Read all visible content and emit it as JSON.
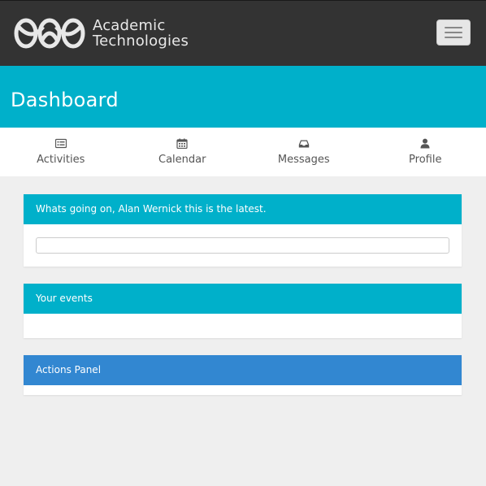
{
  "header": {
    "brand_line1": "Academic",
    "brand_line2": "Technologies"
  },
  "page": {
    "title": "Dashboard"
  },
  "tabs": [
    {
      "label": "Activities",
      "icon": "list-icon"
    },
    {
      "label": "Calendar",
      "icon": "calendar-icon"
    },
    {
      "label": "Messages",
      "icon": "inbox-icon"
    },
    {
      "label": "Profile",
      "icon": "user-icon"
    }
  ],
  "panels": {
    "latest": {
      "heading": "Whats going on, Alan Wernick this is the latest.",
      "input_value": ""
    },
    "events": {
      "heading": "Your events"
    },
    "actions": {
      "heading": "Actions Panel"
    }
  },
  "colors": {
    "navbar": "#333333",
    "accent_teal": "#00b0ca",
    "accent_blue": "#3287d1",
    "background": "#efefef"
  }
}
